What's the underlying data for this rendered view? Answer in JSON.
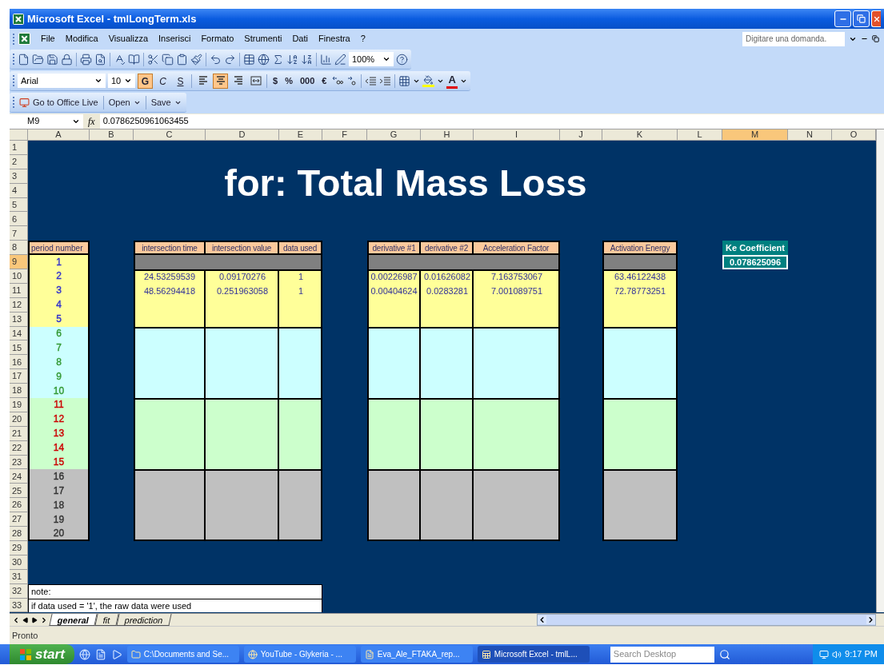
{
  "window": {
    "title": "Microsoft Excel - tmlLongTerm.xls"
  },
  "menu": [
    "File",
    "Modifica",
    "Visualizza",
    "Inserisci",
    "Formato",
    "Strumenti",
    "Dati",
    "Finestra",
    "?"
  ],
  "help_search": {
    "placeholder": "Digitare una domanda."
  },
  "standard_toolbar": {
    "zoom": "100%"
  },
  "formatting_toolbar": {
    "font": "Arial",
    "size": "10",
    "style_buttons": [
      {
        "label": "G",
        "on": true
      },
      {
        "label": "C",
        "on": false
      },
      {
        "label": "S",
        "on": false
      }
    ],
    "alignment": [
      {
        "kind": "left",
        "on": false
      },
      {
        "kind": "center",
        "on": true
      },
      {
        "kind": "right",
        "on": false
      },
      {
        "kind": "merge",
        "on": false
      }
    ],
    "number_buttons": [
      "$",
      "%",
      "000",
      "€"
    ],
    "font_color_label": "A"
  },
  "office_live_toolbar": {
    "buttons": [
      "Go to Office Live",
      "Open",
      "Save"
    ]
  },
  "formula_bar": {
    "name_box": "M9",
    "fx": "fx",
    "formula": "0.0786250961063455"
  },
  "columns": [
    {
      "label": "A",
      "selected": false
    },
    {
      "label": "B",
      "selected": false
    },
    {
      "label": "C",
      "selected": false
    },
    {
      "label": "D",
      "selected": false
    },
    {
      "label": "E",
      "selected": false
    },
    {
      "label": "F",
      "selected": false
    },
    {
      "label": "G",
      "selected": false
    },
    {
      "label": "H",
      "selected": false
    },
    {
      "label": "I",
      "selected": false
    },
    {
      "label": "J",
      "selected": false
    },
    {
      "label": "K",
      "selected": false
    },
    {
      "label": "L",
      "selected": false
    },
    {
      "label": "M",
      "selected": true
    },
    {
      "label": "N",
      "selected": false
    },
    {
      "label": "O",
      "selected": false
    }
  ],
  "rows": [
    {
      "label": "1",
      "selected": false
    },
    {
      "label": "2",
      "selected": false
    },
    {
      "label": "3",
      "selected": false
    },
    {
      "label": "4",
      "selected": false
    },
    {
      "label": "5",
      "selected": false
    },
    {
      "label": "6",
      "selected": false
    },
    {
      "label": "7",
      "selected": false
    },
    {
      "label": "8",
      "selected": false
    },
    {
      "label": "9",
      "selected": true
    },
    {
      "label": "10",
      "selected": false
    },
    {
      "label": "11",
      "selected": false
    },
    {
      "label": "12",
      "selected": false
    },
    {
      "label": "13",
      "selected": false
    },
    {
      "label": "14",
      "selected": false
    },
    {
      "label": "15",
      "selected": false
    },
    {
      "label": "16",
      "selected": false
    },
    {
      "label": "17",
      "selected": false
    },
    {
      "label": "18",
      "selected": false
    },
    {
      "label": "19",
      "selected": false
    },
    {
      "label": "20",
      "selected": false
    },
    {
      "label": "21",
      "selected": false
    },
    {
      "label": "22",
      "selected": false
    },
    {
      "label": "23",
      "selected": false
    },
    {
      "label": "24",
      "selected": false
    },
    {
      "label": "25",
      "selected": false
    },
    {
      "label": "26",
      "selected": false
    },
    {
      "label": "27",
      "selected": false
    },
    {
      "label": "28",
      "selected": false
    },
    {
      "label": "29",
      "selected": false
    },
    {
      "label": "30",
      "selected": false
    },
    {
      "label": "31",
      "selected": false
    },
    {
      "label": "32",
      "selected": false
    },
    {
      "label": "33",
      "selected": false
    }
  ],
  "sheet": {
    "title": "for: Total Mass Loss",
    "period_table": {
      "header": "period number",
      "groups": [
        {
          "color": "#ffff99",
          "values": [
            {
              "label": "1",
              "color": "#3333cc"
            },
            {
              "label": "2",
              "color": "#3333cc"
            },
            {
              "label": "3",
              "color": "#3333cc"
            },
            {
              "label": "4",
              "color": "#3333cc"
            },
            {
              "label": "5",
              "color": "#3333cc"
            }
          ]
        },
        {
          "color": "#ccffff",
          "values": [
            {
              "label": "6",
              "color": "#339933"
            },
            {
              "label": "7",
              "color": "#339933"
            },
            {
              "label": "8",
              "color": "#339933"
            },
            {
              "label": "9",
              "color": "#339933"
            },
            {
              "label": "10",
              "color": "#339933"
            }
          ]
        },
        {
          "color": "#ccffcc",
          "values": [
            {
              "label": "11",
              "color": "#cc0000"
            },
            {
              "label": "12",
              "color": "#cc0000"
            },
            {
              "label": "13",
              "color": "#cc0000"
            },
            {
              "label": "14",
              "color": "#cc0000"
            },
            {
              "label": "15",
              "color": "#cc0000"
            }
          ]
        },
        {
          "color": "#c0c0c0",
          "values": [
            {
              "label": "16",
              "color": "#333333"
            },
            {
              "label": "17",
              "color": "#333333"
            },
            {
              "label": "18",
              "color": "#333333"
            },
            {
              "label": "19",
              "color": "#333333"
            },
            {
              "label": "20",
              "color": "#333333"
            }
          ]
        }
      ]
    },
    "tables": [
      {
        "headers": [
          "intersection time",
          "intersection value",
          "data used"
        ],
        "rows": [
          [
            "24.53259539",
            "0.09170276",
            "1"
          ],
          [
            "48.56294418",
            "0.251963058",
            "1"
          ]
        ]
      },
      {
        "headers": [
          "derivative #1",
          "derivative #2",
          "Acceleration Factor"
        ],
        "rows": [
          [
            "0.00226987",
            "0.01626082",
            "7.163753067"
          ],
          [
            "0.00404624",
            "0.0283281",
            "7.001089751"
          ]
        ]
      },
      {
        "headers": [
          "Activation Energy"
        ],
        "rows": [
          [
            "63.46122438"
          ],
          [
            "72.78773251"
          ]
        ]
      }
    ],
    "ke": {
      "label": "Ke Coefficient",
      "value": "0.078625096",
      "selected": true
    },
    "notes": [
      "note:",
      "if data used = '1', the raw data were used"
    ]
  },
  "sheet_tabs": [
    {
      "label": "general",
      "selected": true
    },
    {
      "label": "fit",
      "selected": false
    },
    {
      "label": "prediction",
      "selected": false
    }
  ],
  "status": "Pronto",
  "taskbar": {
    "start": "start",
    "tasks": [
      {
        "label": "C:\\Documents and Se...",
        "kind": "folder",
        "selected": false
      },
      {
        "label": "YouTube - Glykeria - ...",
        "kind": "browser",
        "selected": false
      },
      {
        "label": "Eva_Ale_FTAKA_rep...",
        "kind": "document",
        "selected": false
      },
      {
        "label": "Microsoft Excel - tmlL...",
        "kind": "spreadsheet",
        "selected": true
      }
    ],
    "search": {
      "placeholder": "Search Desktop"
    },
    "clock": "9:17 PM"
  }
}
